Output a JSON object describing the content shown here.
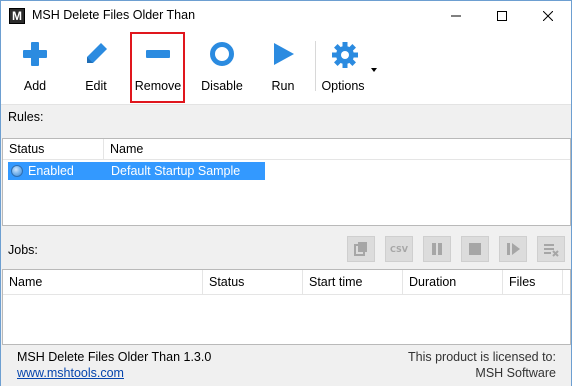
{
  "window": {
    "title": "MSH Delete Files Older Than",
    "app_icon_letter": "M"
  },
  "toolbar": {
    "add_label": "Add",
    "edit_label": "Edit",
    "remove_label": "Remove",
    "disable_label": "Disable",
    "run_label": "Run",
    "options_label": "Options"
  },
  "colors": {
    "accent": "#2b8be0",
    "selection": "#3399ff",
    "highlight_border": "#e0161d"
  },
  "rules": {
    "section_label": "Rules:",
    "columns": [
      "Status",
      "Name"
    ],
    "rows": [
      {
        "status": "Enabled",
        "name": "Default Startup Sample Rule",
        "selected": true
      }
    ]
  },
  "jobs": {
    "section_label": "Jobs:",
    "columns": [
      "Name",
      "Status",
      "Start time",
      "Duration",
      "Files"
    ],
    "tool_icons": [
      "copy-icon",
      "csv-icon",
      "pause-icon",
      "stop-icon",
      "step-icon",
      "clear-icon"
    ],
    "csv_text": "CSV"
  },
  "footer": {
    "product_version": "MSH Delete Files Older Than 1.3.0",
    "website": "www.mshtools.com",
    "license_line1": "This product is licensed to:",
    "license_line2": "MSH Software"
  }
}
